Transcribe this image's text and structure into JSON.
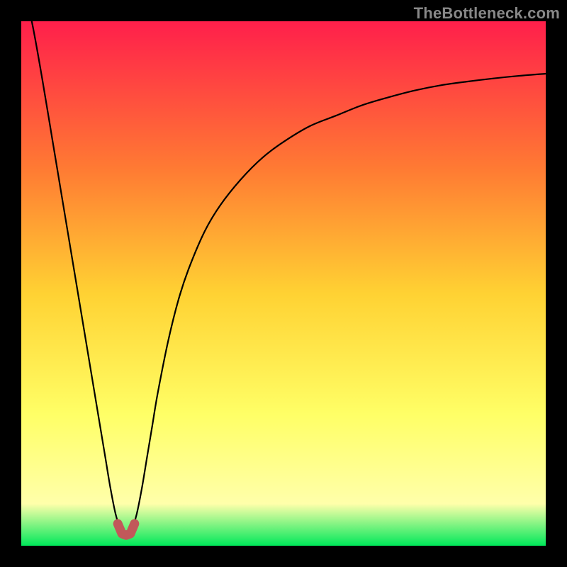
{
  "chart_data": {
    "type": "line",
    "title": "",
    "xlabel": "",
    "ylabel": "",
    "xlim": [
      0,
      100
    ],
    "ylim": [
      0,
      100
    ],
    "x": [
      0,
      2,
      4,
      6,
      8,
      10,
      12,
      14,
      15,
      16,
      17,
      18,
      19,
      20,
      21,
      22,
      23,
      24,
      25,
      26,
      28,
      30,
      32,
      35,
      38,
      42,
      46,
      50,
      55,
      60,
      65,
      70,
      75,
      80,
      85,
      90,
      95,
      100
    ],
    "values": [
      108,
      100,
      89,
      77,
      65,
      53,
      41,
      29,
      23,
      17,
      11,
      6,
      3,
      2,
      3,
      6,
      11,
      17,
      23,
      29,
      39,
      47,
      53,
      60,
      65,
      70,
      74,
      77,
      80,
      82,
      84,
      85.5,
      86.8,
      87.8,
      88.5,
      89.1,
      89.6,
      90
    ],
    "series_name": "bottleneck-curve",
    "colors": {
      "curve": "#000000",
      "marker": "#c1585a",
      "gradient_top": "#ff1f4b",
      "gradient_mid_upper": "#ff7a33",
      "gradient_mid": "#ffd233",
      "gradient_mid_lower": "#ffff66",
      "gradient_lower": "#ffffaa",
      "gradient_bottom": "#00e85a"
    },
    "marker_points_x": [
      18.4,
      19.2,
      20.0,
      20.8,
      21.6
    ],
    "marker_points_y": [
      4.2,
      2.3,
      2.0,
      2.3,
      4.2
    ]
  },
  "watermark": {
    "text": "TheBottleneck.com"
  }
}
